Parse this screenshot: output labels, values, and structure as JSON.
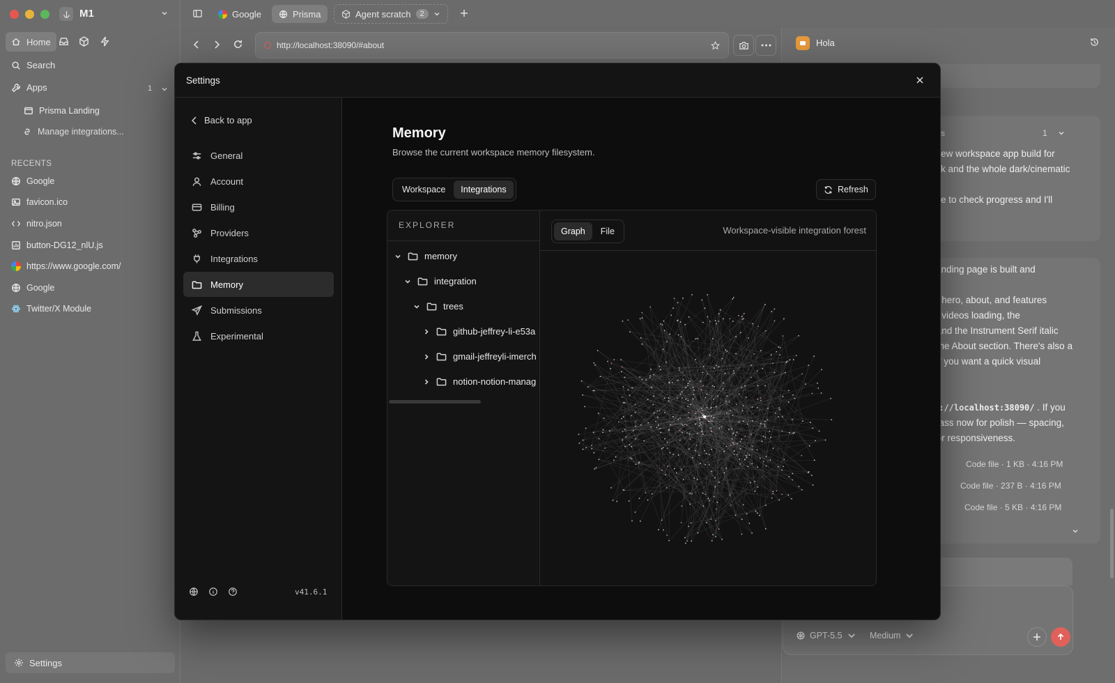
{
  "window": {
    "workspace_name": "M1"
  },
  "sidebar": {
    "home_label": "Home",
    "search_label": "Search",
    "apps_label": "Apps",
    "apps_count": "1",
    "apps_items": [
      {
        "label": "Prisma Landing"
      },
      {
        "label": "Manage integrations..."
      }
    ],
    "recents_heading": "RECENTS",
    "recents": [
      {
        "label": "Google",
        "icon": "globe-icon"
      },
      {
        "label": "favicon.ico",
        "icon": "image-icon"
      },
      {
        "label": "nitro.json",
        "icon": "code-icon"
      },
      {
        "label": "button-DG12_nlU.js",
        "icon": "chart-file-icon"
      },
      {
        "label": "https://www.google.com/",
        "icon": "google-icon"
      },
      {
        "label": "Google",
        "icon": "globe-icon"
      },
      {
        "label": "Twitter/X Module",
        "icon": "react-icon"
      }
    ],
    "settings_label": "Settings"
  },
  "browser": {
    "tabs": [
      {
        "label": "Google"
      },
      {
        "label": "Prisma"
      },
      {
        "label": "Agent scratch",
        "badge": "2"
      }
    ],
    "url": "http://localhost:38090/#about"
  },
  "chat": {
    "title": "Hola",
    "card1_label": "ions",
    "card1_count": "1",
    "card1_lines": [
      "ew workspace app build for",
      "k and the whole dark/cinematic",
      "",
      "e to check progress and I'll"
    ],
    "card2_lines": [
      "landing page is built and",
      "",
      "e hero, about, and features",
      "e videos loading, the",
      " and the Instrument Serif italic",
      " the About section. There's also a",
      " if you want a quick visual"
    ],
    "card2_code": "p://localhost:38090/",
    "card2_after": [
      ". If you",
      "pass now for polish — spacing,",
      " or responsiveness."
    ],
    "files": [
      {
        "meta": "Code file · 1 KB · 4:16 PM"
      },
      {
        "meta": "Code file · 237 B · 4:16 PM"
      },
      {
        "meta": "Code file · 5 KB · 4:16 PM"
      }
    ],
    "model_label": "GPT-5.5",
    "effort_label": "Medium"
  },
  "settings": {
    "title": "Settings",
    "back_label": "Back to app",
    "nav": [
      {
        "label": "General",
        "icon": "sliders-icon"
      },
      {
        "label": "Account",
        "icon": "user-icon"
      },
      {
        "label": "Billing",
        "icon": "card-icon"
      },
      {
        "label": "Providers",
        "icon": "providers-icon"
      },
      {
        "label": "Integrations",
        "icon": "plug-icon"
      },
      {
        "label": "Memory",
        "icon": "folder-icon",
        "active": true
      },
      {
        "label": "Submissions",
        "icon": "send-icon"
      },
      {
        "label": "Experimental",
        "icon": "flask-icon"
      }
    ],
    "version": "v41.6.1",
    "memory": {
      "heading": "Memory",
      "description": "Browse the current workspace memory filesystem.",
      "scope_tabs": [
        {
          "label": "Workspace"
        },
        {
          "label": "Integrations",
          "active": true
        }
      ],
      "refresh_label": "Refresh",
      "explorer_heading": "EXPLORER",
      "tree": [
        {
          "label": "memory",
          "depth": 0,
          "expanded": true
        },
        {
          "label": "integration",
          "depth": 1,
          "expanded": true
        },
        {
          "label": "trees",
          "depth": 2,
          "expanded": true
        },
        {
          "label": "github-jeffrey-li-e53a",
          "depth": 3,
          "expanded": false
        },
        {
          "label": "gmail-jeffreyli-imerch",
          "depth": 3,
          "expanded": false
        },
        {
          "label": "notion-notion-manag",
          "depth": 3,
          "expanded": false
        }
      ],
      "view_tabs": [
        {
          "label": "Graph",
          "active": true
        },
        {
          "label": "File"
        }
      ],
      "graph_caption": "Workspace-visible integration forest"
    }
  },
  "colors": {
    "accent_red": "#e0605a",
    "active_nav": "#2c2c2c",
    "modal_bg": "#0d0d0d"
  }
}
